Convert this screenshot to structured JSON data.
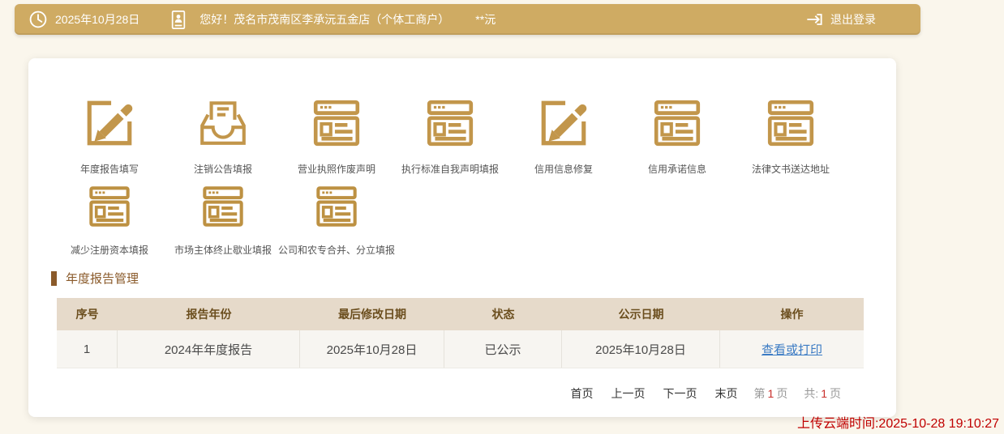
{
  "topbar": {
    "date": "2025年10月28日",
    "greeting": "您好！茂名市茂南区李承沅五金店（个体工商户）",
    "masked_user": "**沅",
    "logout_label": "退出登录"
  },
  "quick_actions": {
    "row1": [
      {
        "label": "年度报告填写",
        "icon": "edit-icon"
      },
      {
        "label": "注销公告填报",
        "icon": "inbox-icon"
      },
      {
        "label": "营业执照作废声明",
        "icon": "browser-icon"
      },
      {
        "label": "执行标准自我声明填报",
        "icon": "browser-icon"
      },
      {
        "label": "信用信息修复",
        "icon": "edit-icon"
      },
      {
        "label": "信用承诺信息",
        "icon": "browser-icon"
      },
      {
        "label": "法律文书送达地址",
        "icon": "browser-icon"
      }
    ],
    "row2": [
      {
        "label": "减少注册资本填报",
        "icon": "browser-icon"
      },
      {
        "label": "市场主体终止歇业填报",
        "icon": "browser-icon"
      },
      {
        "label": "公司和农专合并、分立填报",
        "icon": "browser-icon"
      }
    ]
  },
  "section": {
    "title": "年度报告管理"
  },
  "table": {
    "headers": [
      "序号",
      "报告年份",
      "最后修改日期",
      "状态",
      "公示日期",
      "操作"
    ],
    "rows": [
      {
        "seq": "1",
        "report_year": "2024年年度报告",
        "last_modified": "2025年10月28日",
        "status": "已公示",
        "publish_date": "2025年10月28日",
        "action": "查看或打印"
      }
    ]
  },
  "pagination": {
    "first": "首页",
    "prev": "上一页",
    "next": "下一页",
    "last": "末页",
    "page_prefix": "第",
    "current_page": "1",
    "page_suffix": "页",
    "total_prefix": "共:",
    "total_pages": "1",
    "total_suffix": "页"
  },
  "footer": {
    "upload_time": "上传云端时间:2025-10-28 19:10:27"
  },
  "colors": {
    "topbar_bg": "#CFAB63",
    "page_bg": "#FAF6EC",
    "icon_gold": "#C2964B",
    "title_brown": "#8A5A2A",
    "table_header_bg": "#E6DACA",
    "table_header_text": "#6B4E1E",
    "link_blue": "#3B7BC4",
    "page_number_red": "#C9302C",
    "footer_red": "#C00000"
  }
}
